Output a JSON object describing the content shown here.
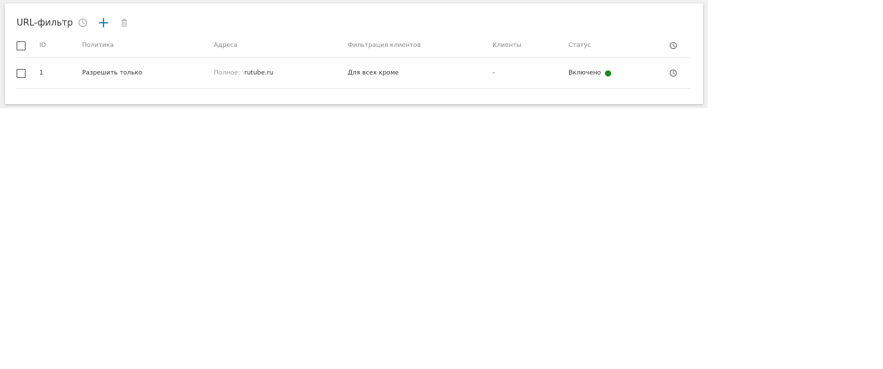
{
  "panel": {
    "title": "URL-фильтр",
    "icons": {
      "schedule": "clock-icon",
      "add": "plus-icon",
      "delete": "trash-icon"
    }
  },
  "table": {
    "columns": [
      "ID",
      "Политика",
      "Адреса",
      "Фильтрация клиентов",
      "Клиенты",
      "Статус"
    ],
    "schedule_column_icon": "clock-icon",
    "rows": [
      {
        "id": "1",
        "policy": "Разрешить только",
        "address_prefix": "Полное:",
        "address": "rutube.ru",
        "client_filter": "Для всех кроме",
        "clients": "-",
        "status": "Включено",
        "status_color": "#1a8a1a",
        "schedule_icon": "clock-icon"
      }
    ]
  },
  "colors": {
    "accent": "#1e7fa8",
    "muted_icon": "#b0b0b0",
    "status_enabled": "#1a8a1a"
  }
}
